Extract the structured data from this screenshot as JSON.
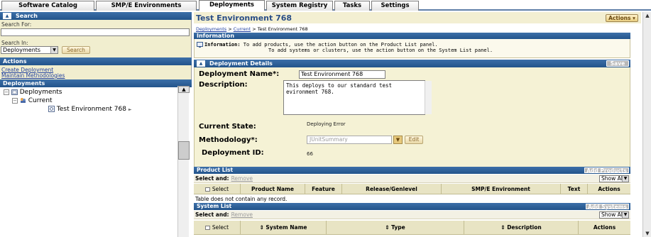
{
  "tabs": [
    {
      "label": "Software Catalog",
      "active": false
    },
    {
      "label": "SMP/E Environments",
      "active": false
    },
    {
      "label": "Deployments",
      "active": true
    },
    {
      "label": "System Registry",
      "active": false
    },
    {
      "label": "Tasks",
      "active": false
    },
    {
      "label": "Settings",
      "active": false
    }
  ],
  "left": {
    "search": {
      "header": "Search",
      "search_for_label": "Search For:",
      "search_for_value": "",
      "search_in_label": "Search In:",
      "search_in_value": "Deployments",
      "search_button": "Search"
    },
    "actions": {
      "header": "Actions",
      "links": [
        "Create Deployment",
        "Maintain Methodologies"
      ]
    },
    "deployments": {
      "header": "Deployments",
      "tree": [
        {
          "label": "Deployments",
          "level": 0,
          "expanded": true
        },
        {
          "label": "Current",
          "level": 1,
          "expanded": true
        },
        {
          "label": "Test Environment 768",
          "level": 2,
          "selected": true
        }
      ]
    }
  },
  "main": {
    "title": "Test Environment 768",
    "actions_button": "Actions",
    "breadcrumb": {
      "items": [
        "Deployments",
        "Current"
      ],
      "separator": ">",
      "current": "Test Environment 768"
    },
    "information": {
      "header": "Information",
      "label": "Information:",
      "line1": "To add products, use the action button on the Product List panel.",
      "line2": "To add systems or clusters, use the action button on the System List panel."
    },
    "details": {
      "header": "Deployment Details",
      "save_button": "Save",
      "name_label": "Deployment Name*:",
      "name_value": "Test Environment 768",
      "description_label": "Description:",
      "description_value": "This deploys to our standard test evironment 768.",
      "state_label": "Current State:",
      "state_value": "Deploying Error",
      "methodology_label": "Methodology*:",
      "methodology_value": "JUnitSummary",
      "edit_button": "Edit",
      "id_label": "Deployment ID:",
      "id_value": "66"
    },
    "product_list": {
      "header": "Product List",
      "add_button": "Add Products",
      "select_and": "Select and:",
      "remove": "Remove",
      "show_all": "Show All",
      "columns": [
        "Select",
        "Product Name",
        "Feature",
        "Release/Genlevel",
        "SMP/E Environment",
        "Text",
        "Actions"
      ],
      "empty_message": "Table does not contain any record."
    },
    "system_list": {
      "header": "System List",
      "add_button": "Add Systems",
      "select_and": "Select and:",
      "remove": "Remove",
      "show_all": "Show All",
      "columns": [
        "Select",
        "System Name",
        "Type",
        "Description",
        "Actions"
      ],
      "sort_icon": "sort-arrows-icon"
    }
  },
  "colors": {
    "header_blue": "#23548b",
    "panel_beige": "#f1eecf",
    "title_blue": "#2a4e86",
    "link_blue": "#1f3fa0"
  }
}
